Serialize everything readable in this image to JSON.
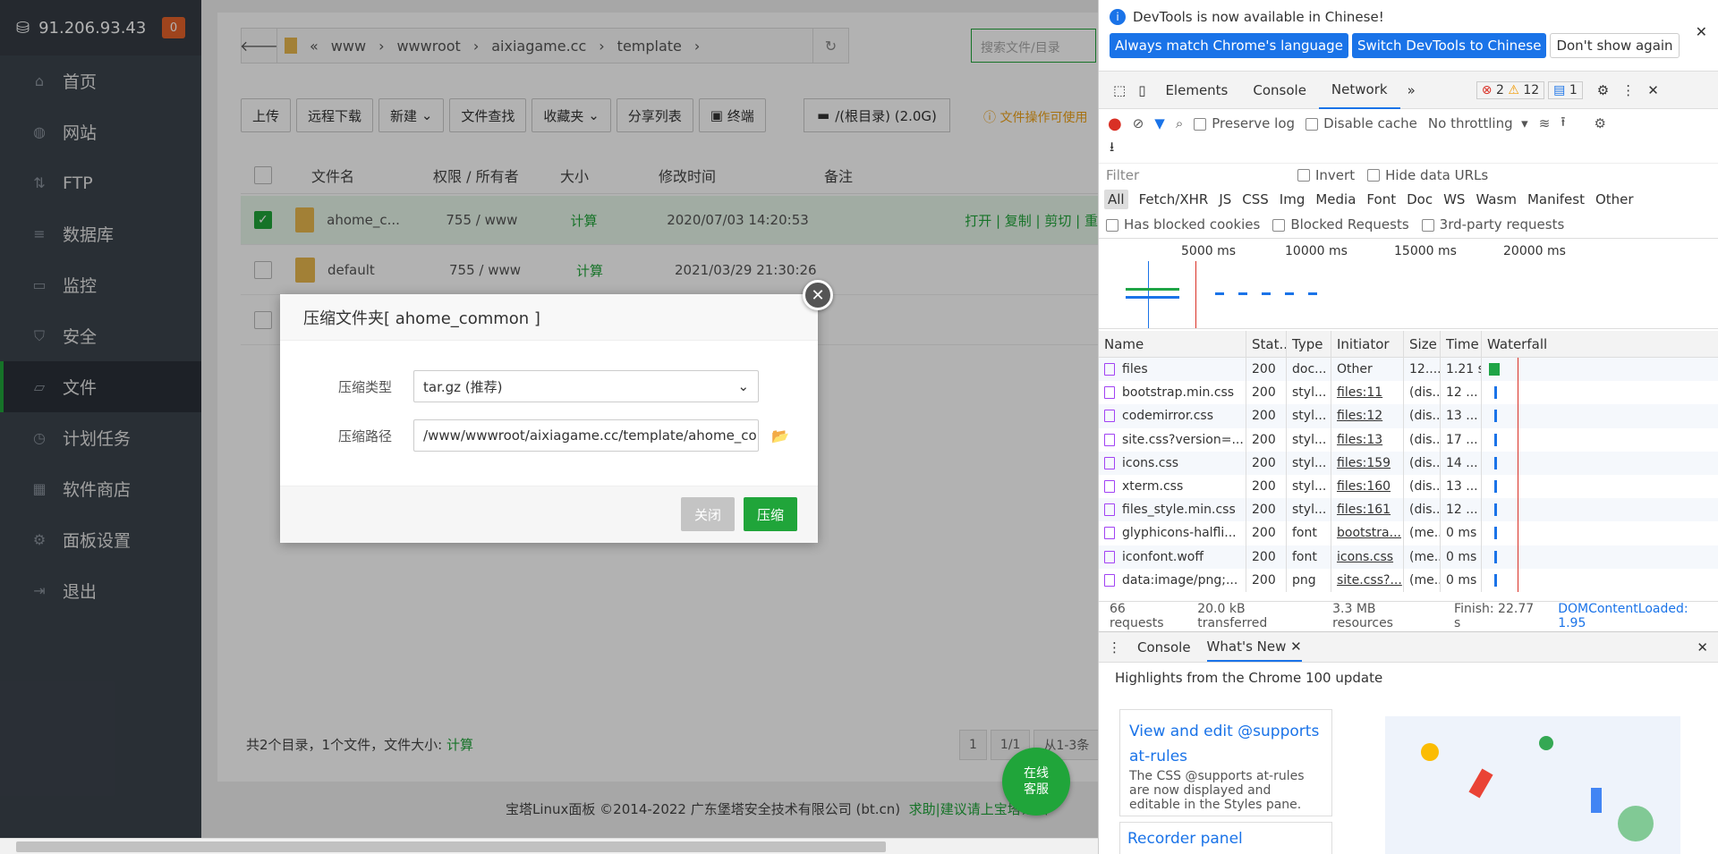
{
  "sidebar": {
    "ip": "91.206.93.43",
    "badge": "0",
    "items": [
      {
        "label": "首页",
        "icon": "home-icon"
      },
      {
        "label": "网站",
        "icon": "globe-icon"
      },
      {
        "label": "FTP",
        "icon": "ftp-icon"
      },
      {
        "label": "数据库",
        "icon": "database-icon"
      },
      {
        "label": "监控",
        "icon": "monitor-icon"
      },
      {
        "label": "安全",
        "icon": "shield-icon"
      },
      {
        "label": "文件",
        "icon": "folder-icon",
        "active": true
      },
      {
        "label": "计划任务",
        "icon": "clock-icon"
      },
      {
        "label": "软件商店",
        "icon": "grid-icon"
      },
      {
        "label": "面板设置",
        "icon": "gear-icon"
      },
      {
        "label": "退出",
        "icon": "logout-icon"
      }
    ]
  },
  "path": {
    "segments": [
      "www",
      "wwwroot",
      "aixiagame.cc",
      "template"
    ],
    "search_placeholder": "搜索文件/目录"
  },
  "toolbar": {
    "upload": "上传",
    "remote": "远程下载",
    "new": "新建",
    "find": "文件查找",
    "fav": "收藏夹",
    "share": "分享列表",
    "terminal": "终端",
    "disk": "/(根目录) (2.0G)",
    "warn": "文件操作可使用"
  },
  "table": {
    "headers": [
      "文件名",
      "权限 / 所有者",
      "大小",
      "修改时间",
      "备注"
    ],
    "rows": [
      {
        "name": "ahome_c...",
        "perm": "755 / www",
        "size": "计算",
        "time": "2020/07/03 14:20:53",
        "actions": "打开 | 复制 | 剪切 | 重"
      },
      {
        "name": "default",
        "perm": "755 / www",
        "size": "计算",
        "time": "2021/03/29 21:30:26",
        "actions": ""
      }
    ]
  },
  "footer": {
    "summary": "共2个目录，1个文件，文件大小:",
    "calc": "计算",
    "pages": [
      "1",
      "1/1",
      "从1-3条"
    ],
    "copyright": "宝塔Linux面板 ©2014-2022 广东堡塔安全技术有限公司 (bt.cn)",
    "help": "求助|建议请上宝塔论坛",
    "chat": "在线\n客服"
  },
  "modal": {
    "title": "压缩文件夹[ ahome_common ]",
    "type_label": "压缩类型",
    "type_value": "tar.gz (推荐)",
    "path_label": "压缩路径",
    "path_value": "/www/wwwroot/aixiagame.cc/template/ahome_com",
    "cancel": "关闭",
    "ok": "压缩"
  },
  "devtools": {
    "info": "DevTools is now available in Chinese!",
    "btn1": "Always match Chrome's language",
    "btn2": "Switch DevTools to Chinese",
    "btn3": "Don't show again",
    "tabs": [
      "Elements",
      "Console",
      "Network"
    ],
    "errors": "2",
    "warnings": "12",
    "messages": "1",
    "preserve": "Preserve log",
    "disable_cache": "Disable cache",
    "throttle": "No throttling",
    "filter": "Filter",
    "invert": "Invert",
    "hide_data": "Hide data URLs",
    "types": [
      "All",
      "Fetch/XHR",
      "JS",
      "CSS",
      "Img",
      "Media",
      "Font",
      "Doc",
      "WS",
      "Wasm",
      "Manifest",
      "Other"
    ],
    "blocked_cookies": "Has blocked cookies",
    "blocked_req": "Blocked Requests",
    "third_party": "3rd-party requests",
    "ticks": [
      "5000 ms",
      "10000 ms",
      "15000 ms",
      "20000 ms"
    ],
    "cols": [
      "Name",
      "Stat..",
      "Type",
      "Initiator",
      "Size",
      "Time",
      "Waterfall"
    ],
    "rows": [
      [
        "files",
        "200",
        "doc...",
        "Other",
        "12....",
        "1.21 s"
      ],
      [
        "bootstrap.min.css",
        "200",
        "styl...",
        "files:11",
        "(dis...",
        "12 ..."
      ],
      [
        "codemirror.css",
        "200",
        "styl...",
        "files:12",
        "(dis...",
        "13 ..."
      ],
      [
        "site.css?version=...",
        "200",
        "styl...",
        "files:13",
        "(dis...",
        "17 ..."
      ],
      [
        "icons.css",
        "200",
        "styl...",
        "files:159",
        "(dis...",
        "14 ..."
      ],
      [
        "xterm.css",
        "200",
        "styl...",
        "files:160",
        "(dis...",
        "13 ..."
      ],
      [
        "files_style.min.css",
        "200",
        "styl...",
        "files:161",
        "(dis...",
        "12 ..."
      ],
      [
        "glyphicons-halfli...",
        "200",
        "font",
        "bootstra...",
        "(me...",
        "0 ms"
      ],
      [
        "iconfont.woff",
        "200",
        "font",
        "icons.css",
        "(me...",
        "0 ms"
      ],
      [
        "data:image/png;...",
        "200",
        "png",
        "site.css?...",
        "(me...",
        "0 ms"
      ]
    ],
    "status": [
      "66 requests",
      "20.0 kB transferred",
      "3.3 MB resources",
      "Finish: 22.77 s",
      "DOMContentLoaded: 1.95"
    ],
    "drawer_tabs": [
      "Console",
      "What's New"
    ],
    "highlights": "Highlights from the Chrome 100 update",
    "card_title": "View and edit @supports at-rules",
    "card_text": "The CSS @supports at-rules are now displayed and editable in the Styles pane.",
    "card2_title": "Recorder panel"
  }
}
